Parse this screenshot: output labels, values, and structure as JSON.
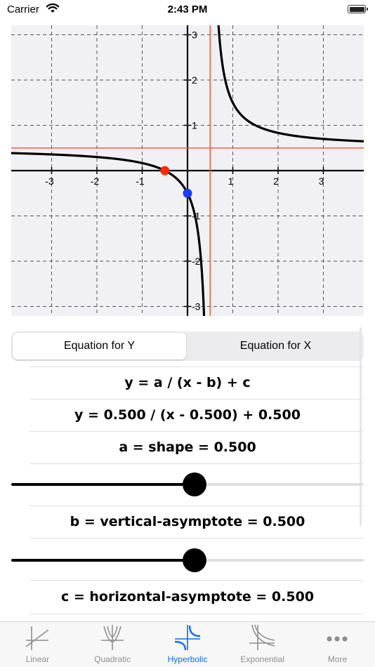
{
  "status_bar": {
    "carrier": "Carrier",
    "time": "2:43 PM"
  },
  "graph": {
    "x_tick_labels": [
      "-3",
      "-2",
      "-1",
      "1",
      "2",
      "3"
    ],
    "y_tick_labels": [
      "3",
      "2",
      "1",
      "-1",
      "-2",
      "-3"
    ],
    "a": 0.5,
    "b": 0.5,
    "c": 0.5,
    "x_intercept_point": [
      -0.5,
      0
    ],
    "y_intercept_point": [
      0,
      -0.5
    ],
    "colors": {
      "curve": "#000000",
      "asymptote": "#ff5a3c",
      "x_intercept": "#ff2a00",
      "y_intercept": "#1a3cff",
      "background": "#f1f1f5",
      "grid": "#555555"
    }
  },
  "segmented": {
    "active": "Equation for Y",
    "inactive": "Equation for X"
  },
  "equation": {
    "general": "y = a / (x - b) + c",
    "current": "y = 0.500 / (x - 0.500) + 0.500"
  },
  "params": [
    {
      "label": "a = shape = 0.500",
      "slider_fraction": 0.52
    },
    {
      "label": "b = vertical-asymptote = 0.500",
      "slider_fraction": 0.52
    },
    {
      "label": "c = horizontal-asymptote = 0.500"
    }
  ],
  "tabs": [
    {
      "label": "Linear",
      "icon": "linear-graph-icon",
      "active": false
    },
    {
      "label": "Quadratic",
      "icon": "quadratic-graph-icon",
      "active": false
    },
    {
      "label": "Hyperbolic",
      "icon": "hyperbolic-graph-icon",
      "active": true
    },
    {
      "label": "Exponential",
      "icon": "exponential-graph-icon",
      "active": false
    },
    {
      "label": "More",
      "icon": "more-icon",
      "active": false
    }
  ]
}
